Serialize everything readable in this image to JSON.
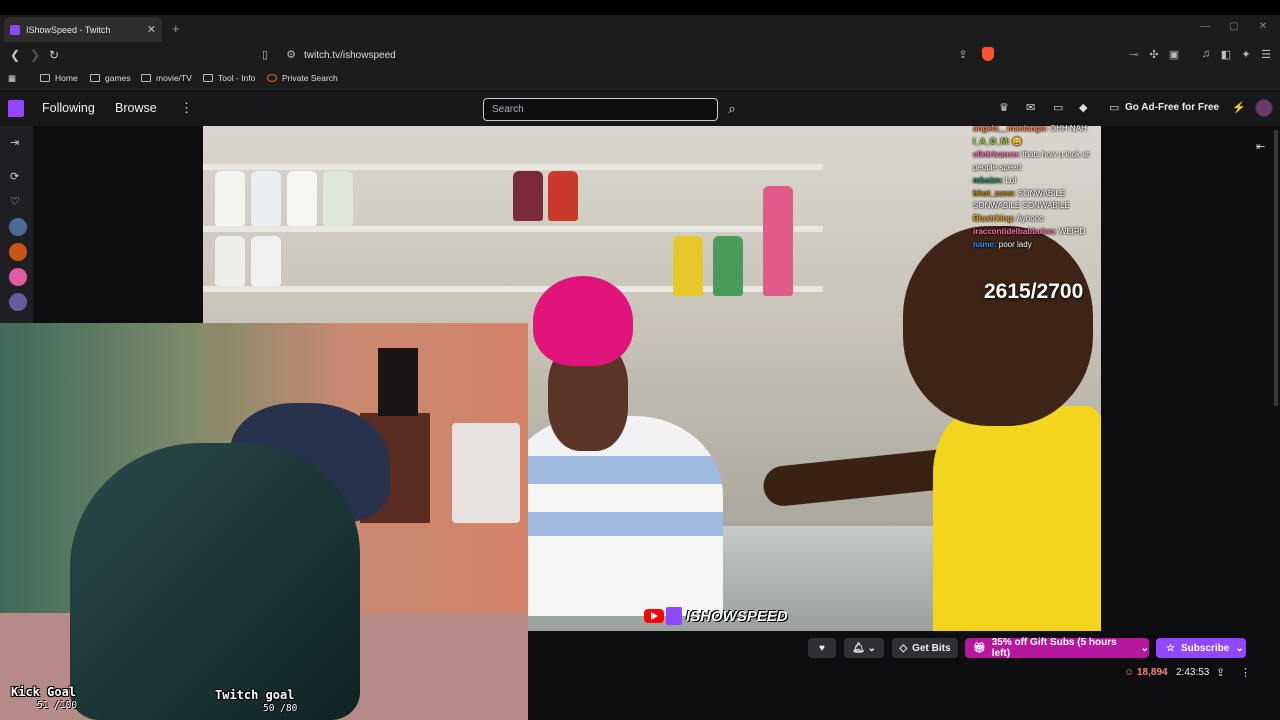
{
  "browser": {
    "tab_title": "IShowSpeed - Twitch",
    "url": "twitch.tv/ishowspeed",
    "bookmarks": [
      "Home",
      "games",
      "movie/TV",
      "Tool - Info",
      "Private Search"
    ]
  },
  "twitch_nav": {
    "following": "Following",
    "browse": "Browse",
    "search_placeholder": "Search",
    "ad_free": "Go Ad-Free for Free"
  },
  "stream": {
    "counter": "2615/2700",
    "brand": "ISHOWSPEED",
    "chat": [
      {
        "user": "angela__manlangu:",
        "msg": " OHH NAH",
        "color": "#ff7f50"
      },
      {
        "user": "I_A_O_M:",
        "msg": " 😄",
        "color": "#9acd32"
      },
      {
        "user": "c0ntrivance:",
        "msg": " thats how u look at people speed",
        "color": "#ff69b4"
      },
      {
        "user": "mbaizn:",
        "msg": " Lol",
        "color": "#2e8b57"
      },
      {
        "user": "bhut_zano:",
        "msg": " SONWABILE SONWABILE SONWABILE",
        "color": "#b8860b"
      },
      {
        "user": "Blastrking:",
        "msg": " Ayoooo",
        "color": "#daa520"
      },
      {
        "user": "iraccontidelbabbuino:",
        "msg": " WEIRD",
        "color": "#ff69b4"
      },
      {
        "user": "name:",
        "msg": " poor lady",
        "color": "#1e90ff"
      }
    ],
    "kick_goal_label": "Kick Goal",
    "kick_goal_value": "51 /100",
    "twitch_goal_label": "Twitch goal",
    "twitch_goal_value": "50 /80"
  },
  "actions": {
    "get_bits": "Get Bits",
    "gift_subs": "35% off Gift Subs (5 hours left)",
    "subscribe": "Subscribe",
    "viewers": "18,894",
    "uptime": "2:43:53"
  },
  "colors": {
    "twitch_purple": "#9146ff",
    "gift_pink": "#b5179e",
    "viewer_red": "#ff8280"
  }
}
